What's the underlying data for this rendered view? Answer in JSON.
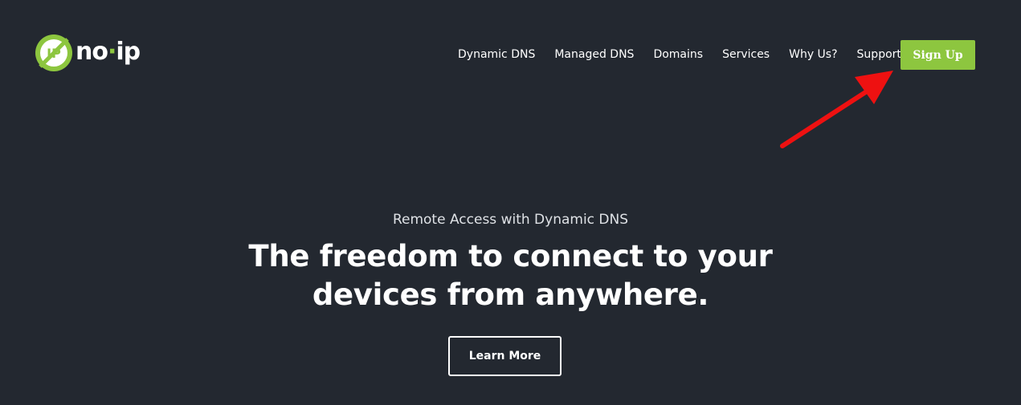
{
  "header": {
    "logo": {
      "text_main": "no",
      "text_dot": "·",
      "text_end": "ip",
      "icon": "noip-logo-icon"
    },
    "nav": [
      {
        "label": "Dynamic DNS"
      },
      {
        "label": "Managed DNS"
      },
      {
        "label": "Domains"
      },
      {
        "label": "Services"
      },
      {
        "label": "Why Us?"
      },
      {
        "label": "Support"
      }
    ],
    "signup_label": "Sign Up"
  },
  "hero": {
    "subtitle": "Remote Access with Dynamic DNS",
    "title": "The freedom to connect to your devices from anywhere.",
    "cta_label": "Learn More"
  },
  "annotation": {
    "icon": "red-arrow-icon",
    "color": "#ee1111"
  },
  "colors": {
    "background": "#232830",
    "accent": "#8dc63f",
    "text": "#ffffff"
  }
}
